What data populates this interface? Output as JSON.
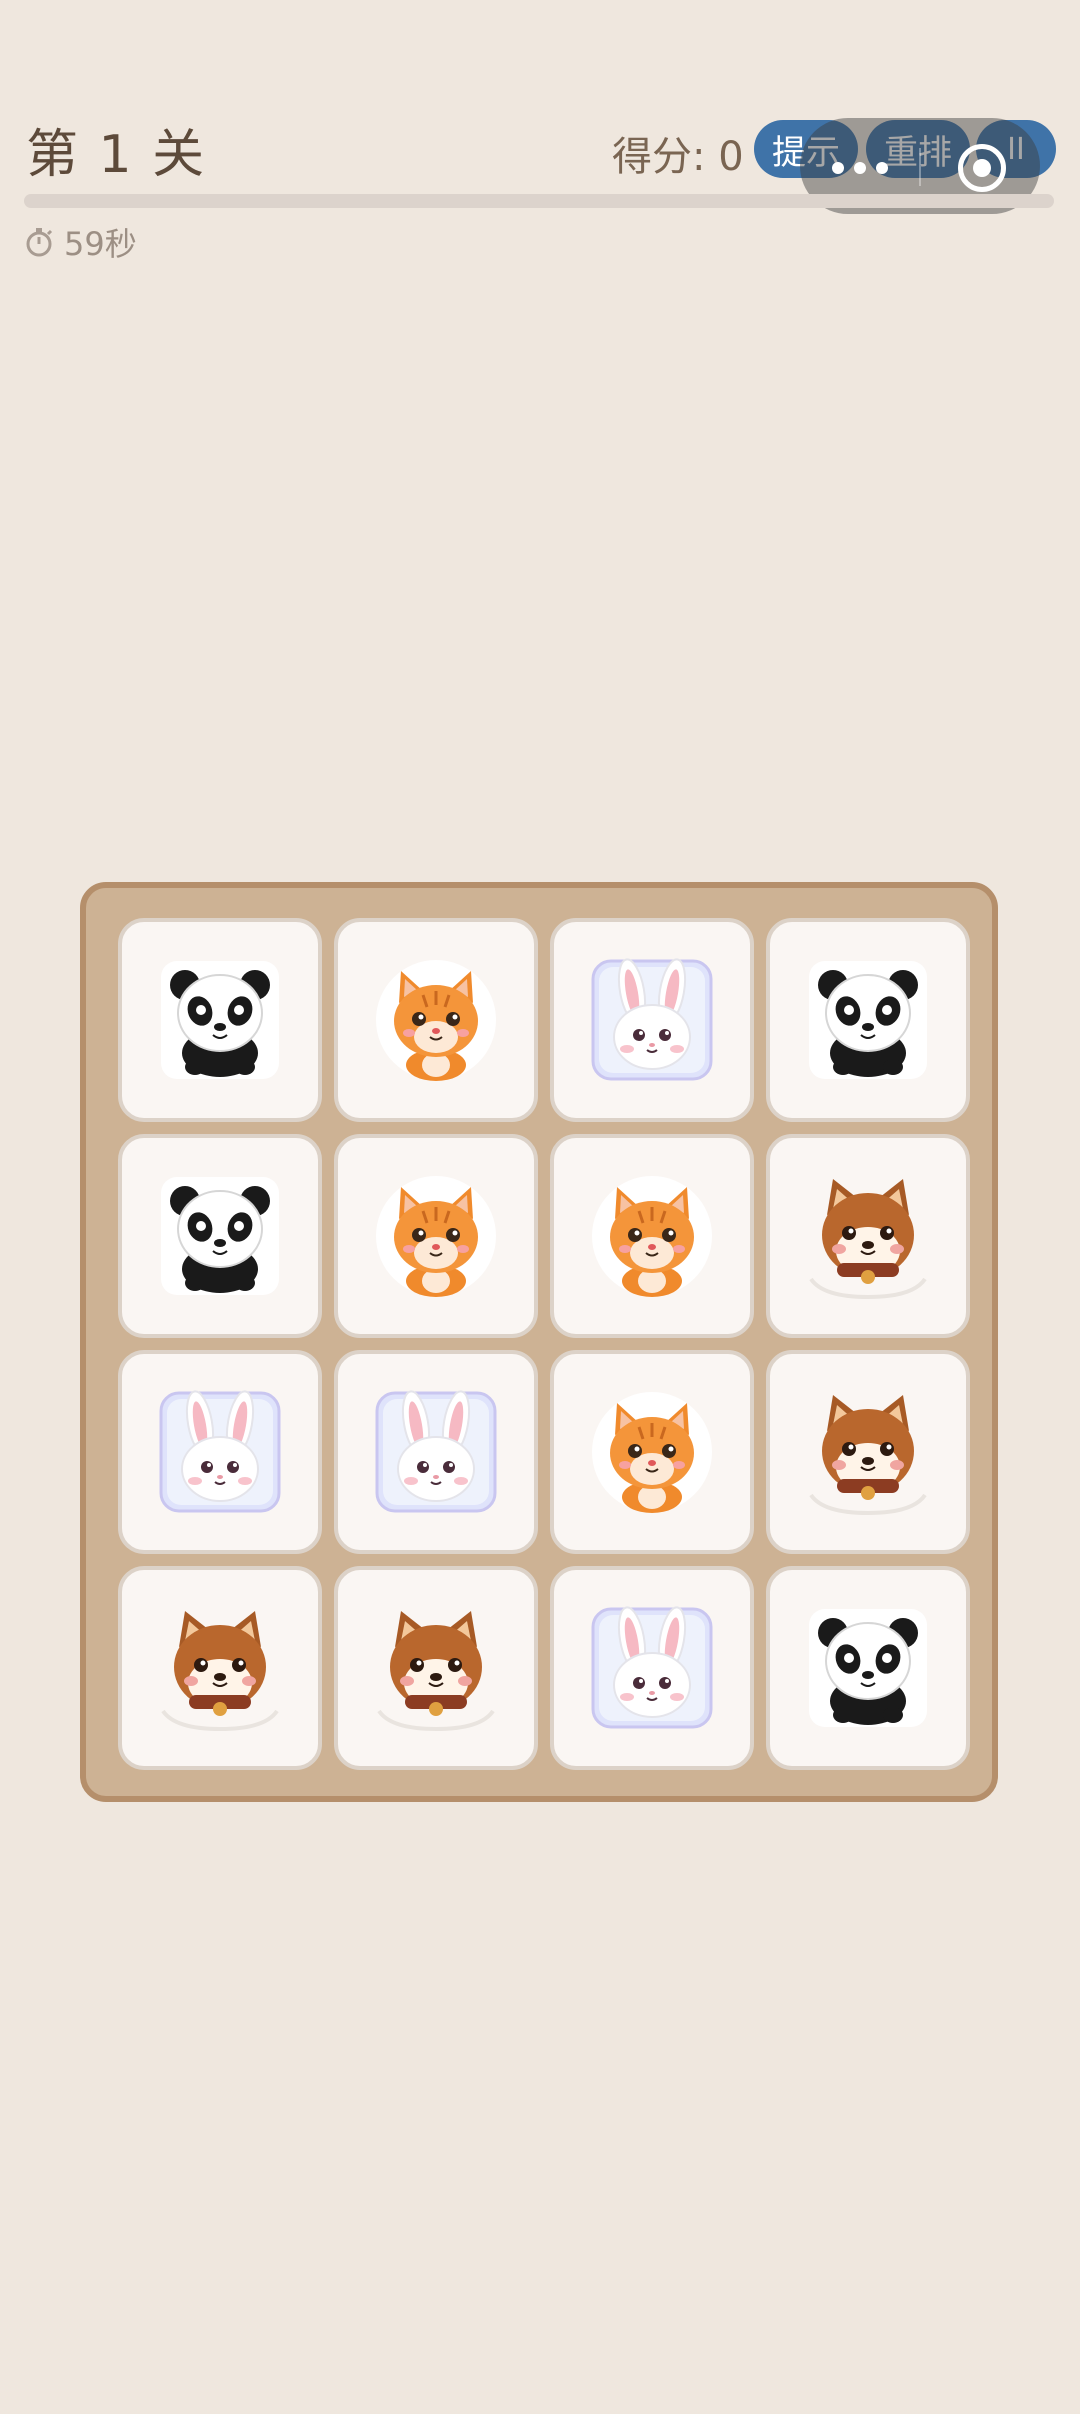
{
  "header": {
    "level_title": "第 1 关",
    "score_text": "得分: 0",
    "hint_label": "提示",
    "shuffle_label": "重排",
    "pause_label": "II"
  },
  "progress": {
    "remaining_fraction": 0.0
  },
  "timer": {
    "text": "59秒",
    "icon": "stopwatch-icon"
  },
  "board": {
    "rows": 4,
    "cols": 4,
    "tiles": [
      [
        "panda",
        "cat",
        "bunny",
        "panda"
      ],
      [
        "panda",
        "cat",
        "cat",
        "shiba"
      ],
      [
        "bunny",
        "bunny",
        "cat",
        "shiba"
      ],
      [
        "shiba",
        "shiba",
        "bunny",
        "panda"
      ]
    ]
  }
}
